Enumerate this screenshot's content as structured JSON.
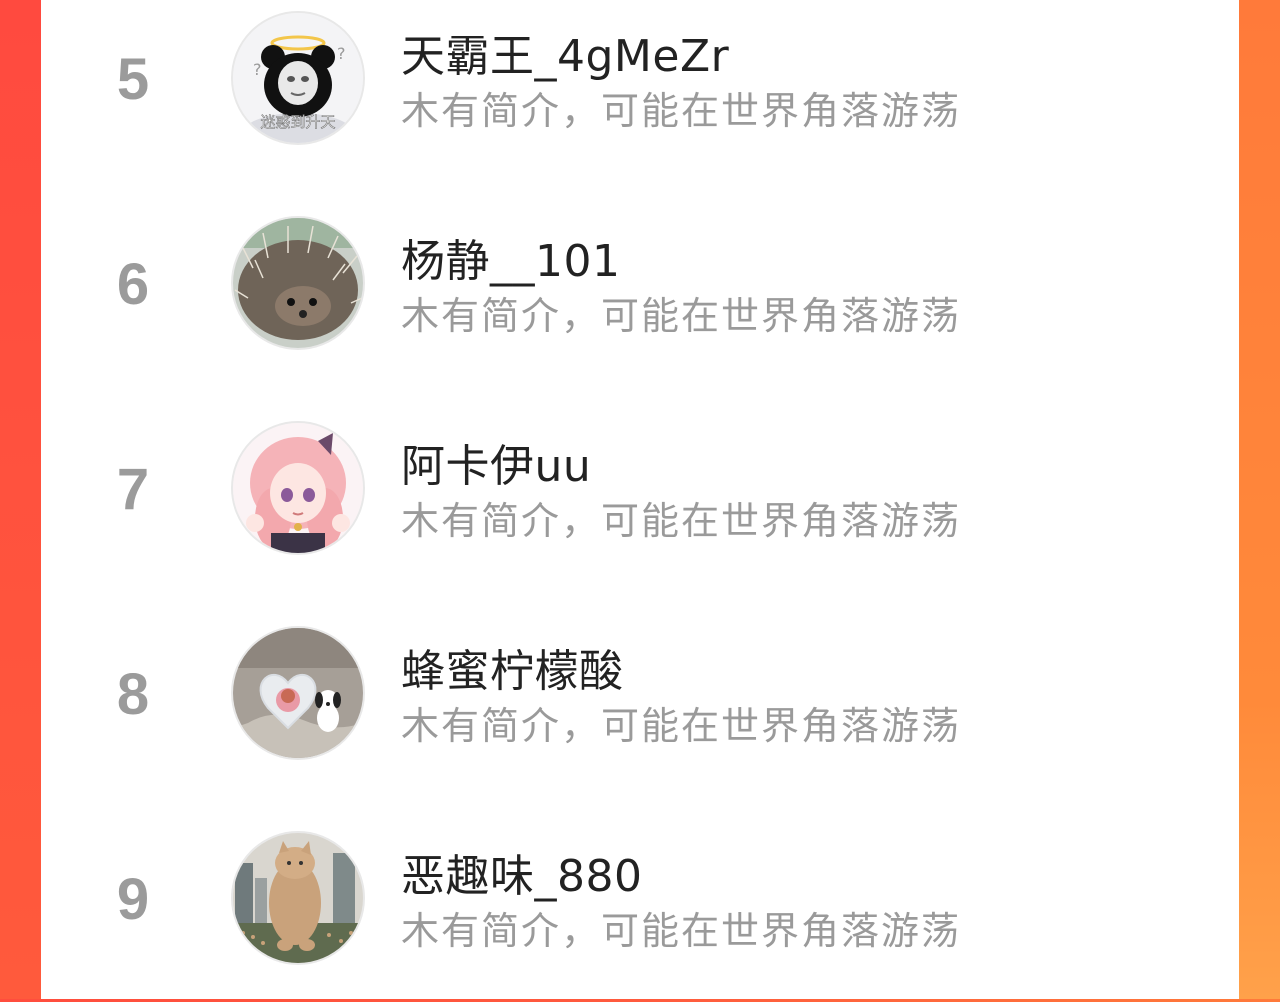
{
  "users": [
    {
      "rank": "5",
      "name": "天霸王_4gMeZr",
      "bio": "木有简介，可能在世界角落游荡",
      "avatar_icon": "panda-meme-avatar",
      "avatar_caption": "迷惑到升天"
    },
    {
      "rank": "6",
      "name": "杨静__101",
      "bio": "木有简介，可能在世界角落游荡",
      "avatar_icon": "hedgehog-avatar"
    },
    {
      "rank": "7",
      "name": "阿卡伊uu",
      "bio": "木有简介，可能在世界角落游荡",
      "avatar_icon": "anime-girl-avatar"
    },
    {
      "rank": "8",
      "name": "蜂蜜柠檬酸",
      "bio": "木有简介，可能在世界角落游荡",
      "avatar_icon": "heart-mirror-dog-avatar"
    },
    {
      "rank": "9",
      "name": "恶趣味_880",
      "bio": "木有简介，可能在世界角落游荡",
      "avatar_icon": "giant-cat-city-avatar"
    }
  ],
  "colors": {
    "accent_left": "#ff4d3d",
    "accent_right": "#ff7a3a",
    "rank_text": "#9b9b9b",
    "name_text": "#222222",
    "bio_text": "#9a9a9a"
  }
}
